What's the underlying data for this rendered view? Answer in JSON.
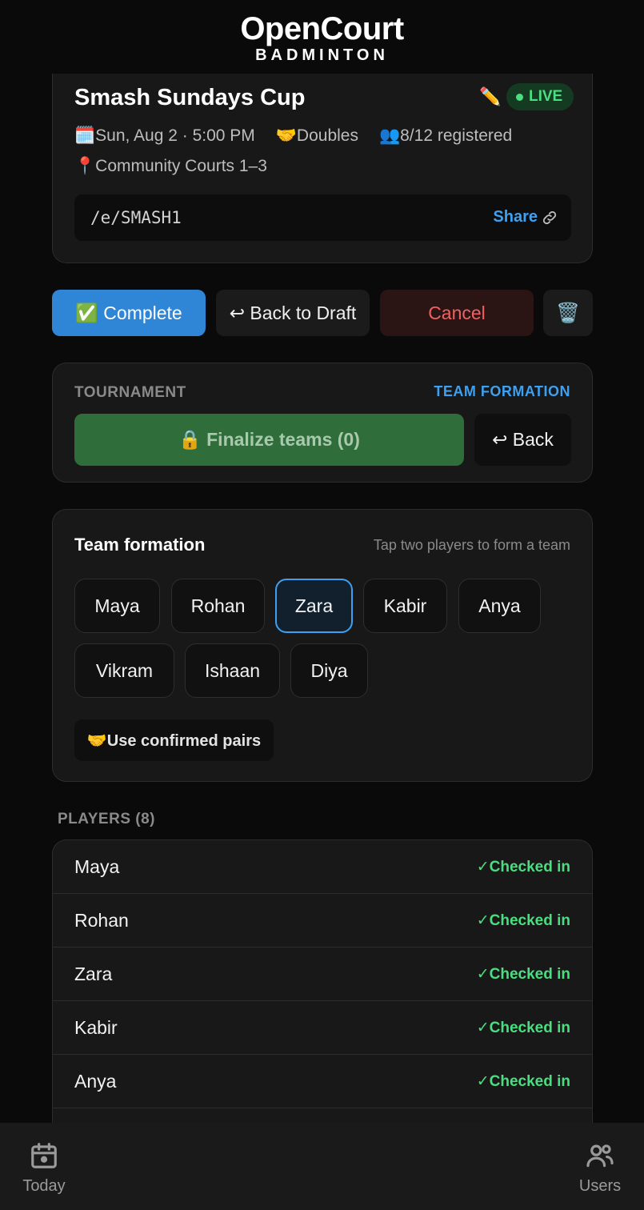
{
  "brand": {
    "title": "OpenCourt",
    "subtitle": "BADMINTON"
  },
  "event": {
    "title": "Smash Sundays Cup",
    "status": "LIVE",
    "date": "🗓️Sun, Aug 2 · 5:00 PM",
    "format": "🤝Doubles",
    "registered": "👥8/12 registered",
    "location": "📍Community Courts 1–3",
    "link": "/e/SMASH1",
    "share_label": "Share"
  },
  "actions": {
    "complete": "✅ Complete",
    "back_to_draft": "↩ Back to Draft",
    "cancel": "Cancel",
    "delete": "🗑️"
  },
  "tournament": {
    "section_label": "TOURNAMENT",
    "stage": "TEAM FORMATION",
    "finalize": "🔒 Finalize teams (0)",
    "back": "↩ Back"
  },
  "team_formation": {
    "title": "Team formation",
    "hint": "Tap two players to form a team",
    "players": [
      "Maya",
      "Rohan",
      "Zara",
      "Kabir",
      "Anya",
      "Vikram",
      "Ishaan",
      "Diya"
    ],
    "selected": "Zara",
    "use_pairs": "🤝Use confirmed pairs"
  },
  "players": {
    "label": "PLAYERS (8)",
    "rows": [
      {
        "name": "Maya",
        "status": "✓Checked in"
      },
      {
        "name": "Rohan",
        "status": "✓Checked in"
      },
      {
        "name": "Zara",
        "status": "✓Checked in"
      },
      {
        "name": "Kabir",
        "status": "✓Checked in"
      },
      {
        "name": "Anya",
        "status": "✓Checked in"
      }
    ]
  },
  "nav": {
    "today": "Today",
    "users": "Users"
  },
  "colors": {
    "accent": "#3ea0f0",
    "success": "#4ade80",
    "danger": "#f06262",
    "complete": "#2f86d6"
  }
}
